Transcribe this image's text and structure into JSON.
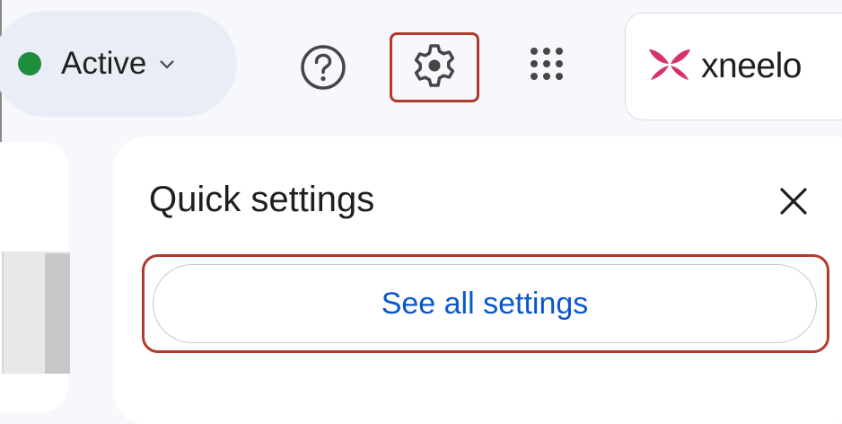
{
  "header": {
    "status": {
      "label": "Active",
      "color": "#1e8e3e",
      "icon": "chevron-down-icon"
    },
    "help_icon": "help-circle-icon",
    "settings_icon": "gear-icon",
    "apps_icon": "apps-grid-icon",
    "account": {
      "brand": "xneelo",
      "brand_color": "#d6336c",
      "logo_icon": "xneelo-logo-icon"
    }
  },
  "quick_settings": {
    "title": "Quick settings",
    "close_icon": "close-icon",
    "see_all_label": "See all settings"
  },
  "colors": {
    "highlight": "#b03a2e",
    "link": "#0b57d0",
    "background": "#f6f8fc"
  }
}
